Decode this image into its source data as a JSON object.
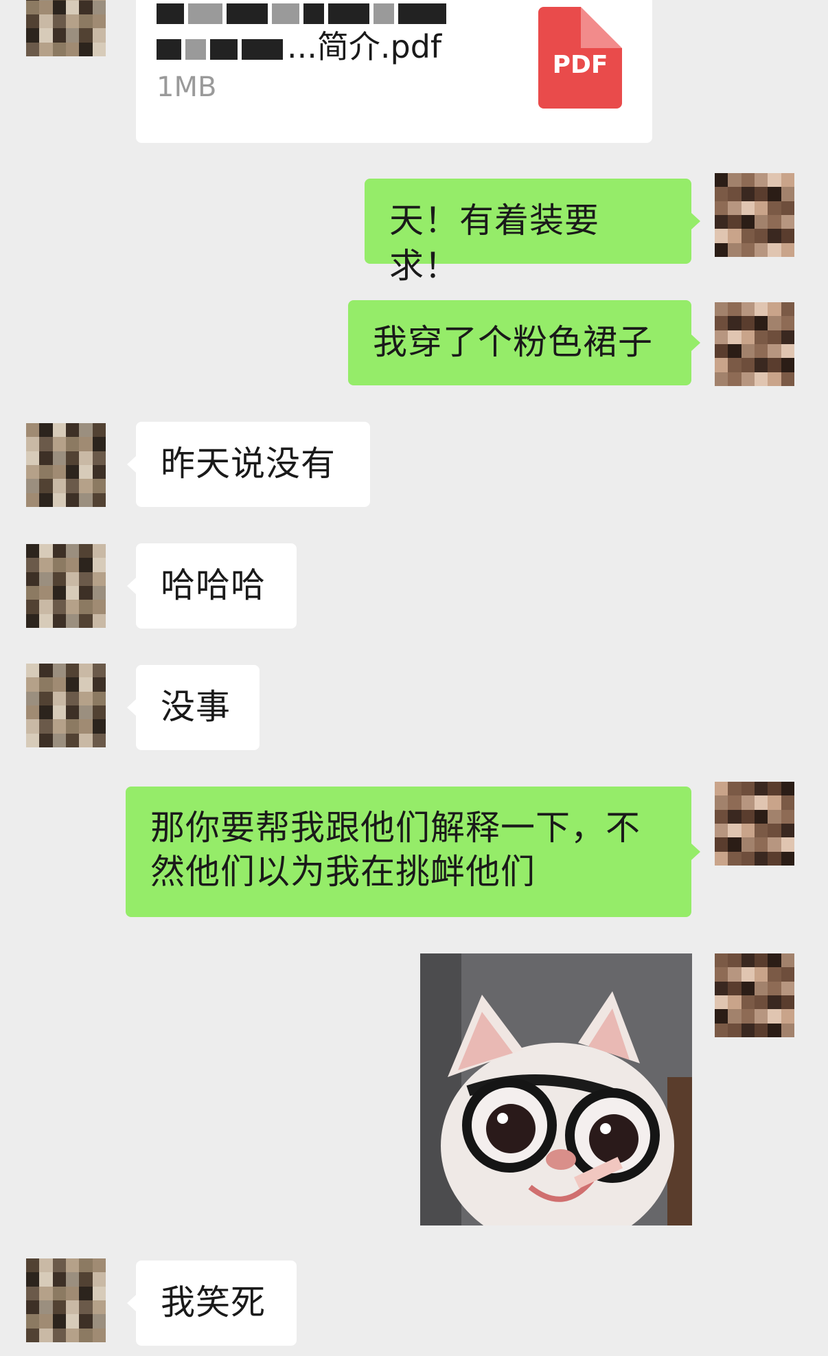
{
  "file_message": {
    "name_line1": "",
    "name_line2": "...简介.pdf",
    "size": "1MB",
    "icon_label": "PDF",
    "icon": "pdf-file-icon"
  },
  "messages": [
    {
      "side": "right",
      "text": "天！有着装要求！"
    },
    {
      "side": "right",
      "text": "我穿了个粉色裙子"
    },
    {
      "side": "left",
      "text": "昨天说没有"
    },
    {
      "side": "left",
      "text": "哈哈哈"
    },
    {
      "side": "left",
      "text": "没事"
    },
    {
      "side": "right",
      "text": "那你要帮我跟他们解释一下，不然他们以为我在挑衅他们"
    },
    {
      "side": "right",
      "type": "sticker",
      "description": "dog-with-glasses-sticker"
    },
    {
      "side": "left",
      "text": "我笑死"
    }
  ],
  "colors": {
    "background": "#ededed",
    "sent_bubble": "#95ec69",
    "received_bubble": "#ffffff",
    "pdf_icon": "#e94b4b"
  }
}
